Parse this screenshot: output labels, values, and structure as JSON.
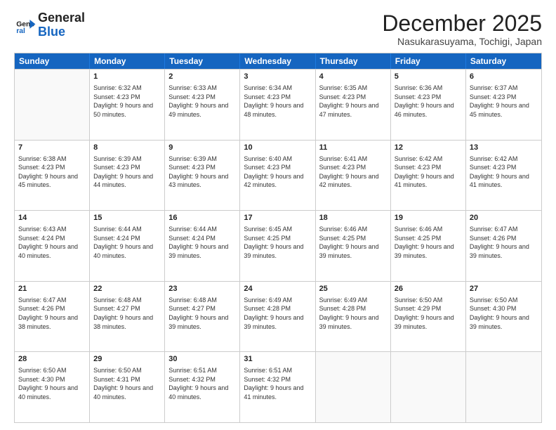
{
  "header": {
    "logo_line1": "General",
    "logo_line2": "Blue",
    "month_title": "December 2025",
    "location": "Nasukarasuyama, Tochigi, Japan"
  },
  "days_of_week": [
    "Sunday",
    "Monday",
    "Tuesday",
    "Wednesday",
    "Thursday",
    "Friday",
    "Saturday"
  ],
  "weeks": [
    [
      {
        "day": "",
        "empty": true
      },
      {
        "day": "1",
        "sunrise": "6:32 AM",
        "sunset": "4:23 PM",
        "daylight": "9 hours and 50 minutes."
      },
      {
        "day": "2",
        "sunrise": "6:33 AM",
        "sunset": "4:23 PM",
        "daylight": "9 hours and 49 minutes."
      },
      {
        "day": "3",
        "sunrise": "6:34 AM",
        "sunset": "4:23 PM",
        "daylight": "9 hours and 48 minutes."
      },
      {
        "day": "4",
        "sunrise": "6:35 AM",
        "sunset": "4:23 PM",
        "daylight": "9 hours and 47 minutes."
      },
      {
        "day": "5",
        "sunrise": "6:36 AM",
        "sunset": "4:23 PM",
        "daylight": "9 hours and 46 minutes."
      },
      {
        "day": "6",
        "sunrise": "6:37 AM",
        "sunset": "4:23 PM",
        "daylight": "9 hours and 45 minutes."
      }
    ],
    [
      {
        "day": "7",
        "sunrise": "6:38 AM",
        "sunset": "4:23 PM",
        "daylight": "9 hours and 45 minutes."
      },
      {
        "day": "8",
        "sunrise": "6:39 AM",
        "sunset": "4:23 PM",
        "daylight": "9 hours and 44 minutes."
      },
      {
        "day": "9",
        "sunrise": "6:39 AM",
        "sunset": "4:23 PM",
        "daylight": "9 hours and 43 minutes."
      },
      {
        "day": "10",
        "sunrise": "6:40 AM",
        "sunset": "4:23 PM",
        "daylight": "9 hours and 42 minutes."
      },
      {
        "day": "11",
        "sunrise": "6:41 AM",
        "sunset": "4:23 PM",
        "daylight": "9 hours and 42 minutes."
      },
      {
        "day": "12",
        "sunrise": "6:42 AM",
        "sunset": "4:23 PM",
        "daylight": "9 hours and 41 minutes."
      },
      {
        "day": "13",
        "sunrise": "6:42 AM",
        "sunset": "4:23 PM",
        "daylight": "9 hours and 41 minutes."
      }
    ],
    [
      {
        "day": "14",
        "sunrise": "6:43 AM",
        "sunset": "4:24 PM",
        "daylight": "9 hours and 40 minutes."
      },
      {
        "day": "15",
        "sunrise": "6:44 AM",
        "sunset": "4:24 PM",
        "daylight": "9 hours and 40 minutes."
      },
      {
        "day": "16",
        "sunrise": "6:44 AM",
        "sunset": "4:24 PM",
        "daylight": "9 hours and 39 minutes."
      },
      {
        "day": "17",
        "sunrise": "6:45 AM",
        "sunset": "4:25 PM",
        "daylight": "9 hours and 39 minutes."
      },
      {
        "day": "18",
        "sunrise": "6:46 AM",
        "sunset": "4:25 PM",
        "daylight": "9 hours and 39 minutes."
      },
      {
        "day": "19",
        "sunrise": "6:46 AM",
        "sunset": "4:25 PM",
        "daylight": "9 hours and 39 minutes."
      },
      {
        "day": "20",
        "sunrise": "6:47 AM",
        "sunset": "4:26 PM",
        "daylight": "9 hours and 39 minutes."
      }
    ],
    [
      {
        "day": "21",
        "sunrise": "6:47 AM",
        "sunset": "4:26 PM",
        "daylight": "9 hours and 38 minutes."
      },
      {
        "day": "22",
        "sunrise": "6:48 AM",
        "sunset": "4:27 PM",
        "daylight": "9 hours and 38 minutes."
      },
      {
        "day": "23",
        "sunrise": "6:48 AM",
        "sunset": "4:27 PM",
        "daylight": "9 hours and 39 minutes."
      },
      {
        "day": "24",
        "sunrise": "6:49 AM",
        "sunset": "4:28 PM",
        "daylight": "9 hours and 39 minutes."
      },
      {
        "day": "25",
        "sunrise": "6:49 AM",
        "sunset": "4:28 PM",
        "daylight": "9 hours and 39 minutes."
      },
      {
        "day": "26",
        "sunrise": "6:50 AM",
        "sunset": "4:29 PM",
        "daylight": "9 hours and 39 minutes."
      },
      {
        "day": "27",
        "sunrise": "6:50 AM",
        "sunset": "4:30 PM",
        "daylight": "9 hours and 39 minutes."
      }
    ],
    [
      {
        "day": "28",
        "sunrise": "6:50 AM",
        "sunset": "4:30 PM",
        "daylight": "9 hours and 40 minutes."
      },
      {
        "day": "29",
        "sunrise": "6:50 AM",
        "sunset": "4:31 PM",
        "daylight": "9 hours and 40 minutes."
      },
      {
        "day": "30",
        "sunrise": "6:51 AM",
        "sunset": "4:32 PM",
        "daylight": "9 hours and 40 minutes."
      },
      {
        "day": "31",
        "sunrise": "6:51 AM",
        "sunset": "4:32 PM",
        "daylight": "9 hours and 41 minutes."
      },
      {
        "day": "",
        "empty": true
      },
      {
        "day": "",
        "empty": true
      },
      {
        "day": "",
        "empty": true
      }
    ]
  ]
}
